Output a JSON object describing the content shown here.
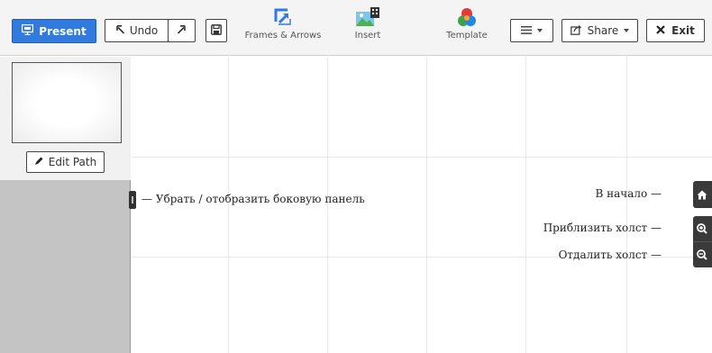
{
  "toolbar": {
    "present_label": "Present",
    "undo_label": "Undo",
    "frames_label": "Frames & Arrows",
    "insert_label": "Insert",
    "template_label": "Template",
    "share_label": "Share",
    "exit_label": "Exit"
  },
  "sidebar": {
    "edit_path_label": "Edit Path"
  },
  "canvas": {
    "toggle_hint": "— Убрать / отобразить боковую панель",
    "home_hint": "В начало —",
    "zoom_in_hint": "Приблизить холст —",
    "zoom_out_hint": "Отдалить холст —"
  },
  "colors": {
    "present_blue": "#2f7be0",
    "sidebar_gray": "#c4c4c4",
    "nav_dark": "#3a3a3a"
  },
  "icons": {
    "present": "projector-icon",
    "undo": "undo-arrow-icon",
    "redo": "redo-arrow-icon",
    "save": "floppy-disk-icon",
    "frames": "frame-arrow-icon",
    "insert": "image-insert-icon",
    "template": "color-circles-icon",
    "menu": "hamburger-icon",
    "share": "share-icon",
    "exit": "close-icon",
    "edit_path": "pencil-icon",
    "home": "home-icon",
    "zoom_in": "zoom-in-icon",
    "zoom_out": "zoom-out-icon"
  }
}
